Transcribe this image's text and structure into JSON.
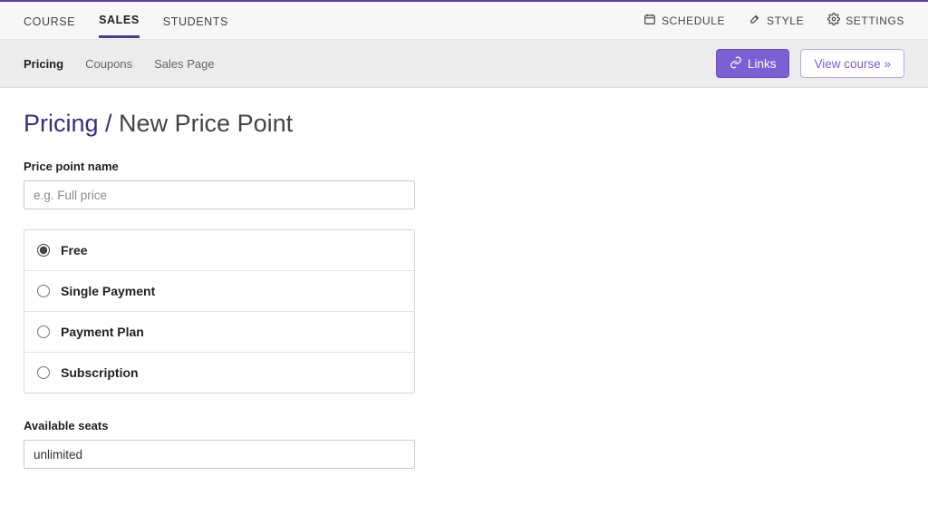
{
  "main_nav": {
    "left": [
      {
        "label": "COURSE"
      },
      {
        "label": "SALES"
      },
      {
        "label": "STUDENTS"
      }
    ],
    "right": [
      {
        "label": "SCHEDULE",
        "icon": "calendar"
      },
      {
        "label": "STYLE",
        "icon": "brush"
      },
      {
        "label": "SETTINGS",
        "icon": "gear"
      }
    ]
  },
  "sub_nav": {
    "left": [
      {
        "label": "Pricing"
      },
      {
        "label": "Coupons"
      },
      {
        "label": "Sales Page"
      }
    ],
    "links_button": "Links",
    "view_course_button": "View course »"
  },
  "page": {
    "breadcrumb_root": "Pricing /",
    "breadcrumb_current": " New Price Point"
  },
  "form": {
    "name_label": "Price point name",
    "name_placeholder": "e.g. Full price",
    "options": [
      {
        "label": "Free"
      },
      {
        "label": "Single Payment"
      },
      {
        "label": "Payment Plan"
      },
      {
        "label": "Subscription"
      }
    ],
    "seats_label": "Available seats",
    "seats_value": "unlimited"
  }
}
